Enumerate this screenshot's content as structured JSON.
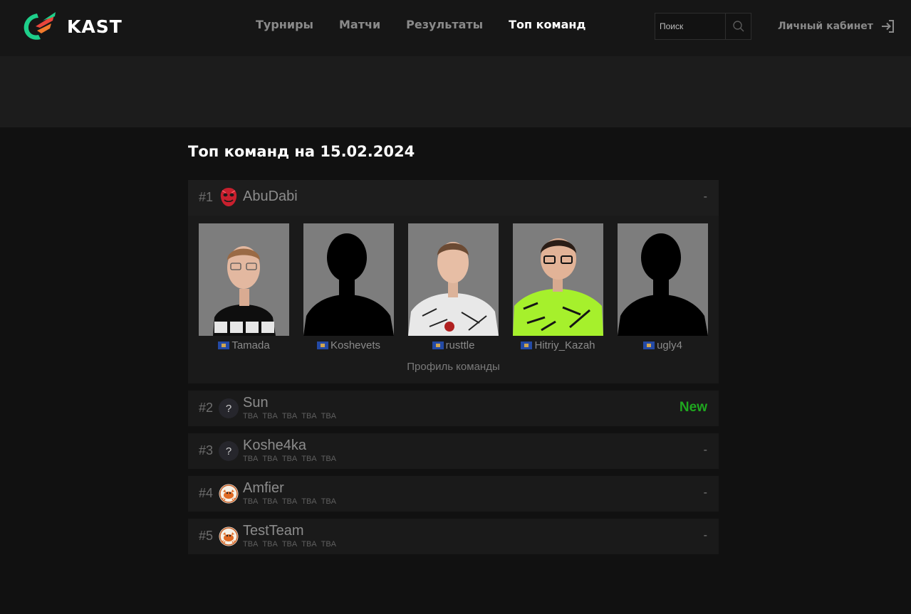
{
  "header": {
    "brand": "KAST",
    "nav": [
      {
        "label": "Турниры",
        "active": false
      },
      {
        "label": "Матчи",
        "active": false
      },
      {
        "label": "Результаты",
        "active": false
      },
      {
        "label": "Топ команд",
        "active": true
      }
    ],
    "search": {
      "placeholder": "Поиск",
      "value": ""
    },
    "cabinet_label": "Личный кабинет"
  },
  "page_title": "Топ команд на 15.02.2024",
  "teams": [
    {
      "rank": "#1",
      "name": "AbuDabi",
      "trend": "-",
      "logo_icon": "red-mask-logo",
      "players": [
        {
          "name": "Tamada",
          "flag": "kosovo-flag",
          "photo": "photo"
        },
        {
          "name": "Koshevets",
          "flag": "kosovo-flag",
          "photo": "silhouette"
        },
        {
          "name": "rusttle",
          "flag": "kosovo-flag",
          "photo": "photo"
        },
        {
          "name": "Hitriy_Kazah",
          "flag": "kosovo-flag",
          "photo": "photo"
        },
        {
          "name": "ugly4",
          "flag": "kosovo-flag",
          "photo": "silhouette"
        }
      ],
      "profile_link": "Профиль команды"
    },
    {
      "rank": "#2",
      "name": "Sun",
      "trend": "New",
      "logo_icon": "question-logo",
      "logo_text": "?",
      "players": [
        "TBA",
        "TBA",
        "TBA",
        "TBA",
        "TBA"
      ]
    },
    {
      "rank": "#3",
      "name": "Koshe4ka",
      "trend": "-",
      "logo_icon": "question-logo",
      "logo_text": "?",
      "players": [
        "TBA",
        "TBA",
        "TBA",
        "TBA",
        "TBA"
      ]
    },
    {
      "rank": "#4",
      "name": "Amfier",
      "trend": "-",
      "logo_icon": "crab-logo",
      "players": [
        "TBA",
        "TBA",
        "TBA",
        "TBA",
        "TBA"
      ]
    },
    {
      "rank": "#5",
      "name": "TestTeam",
      "trend": "-",
      "logo_icon": "crab-logo",
      "players": [
        "TBA",
        "TBA",
        "TBA",
        "TBA",
        "TBA"
      ]
    }
  ],
  "colors": {
    "background": "#111111",
    "header": "#161616",
    "card": "#1a1a1a",
    "new_trend": "#1fa81f",
    "brand_green": "#1ecf8a",
    "brand_red": "#e8453c"
  }
}
